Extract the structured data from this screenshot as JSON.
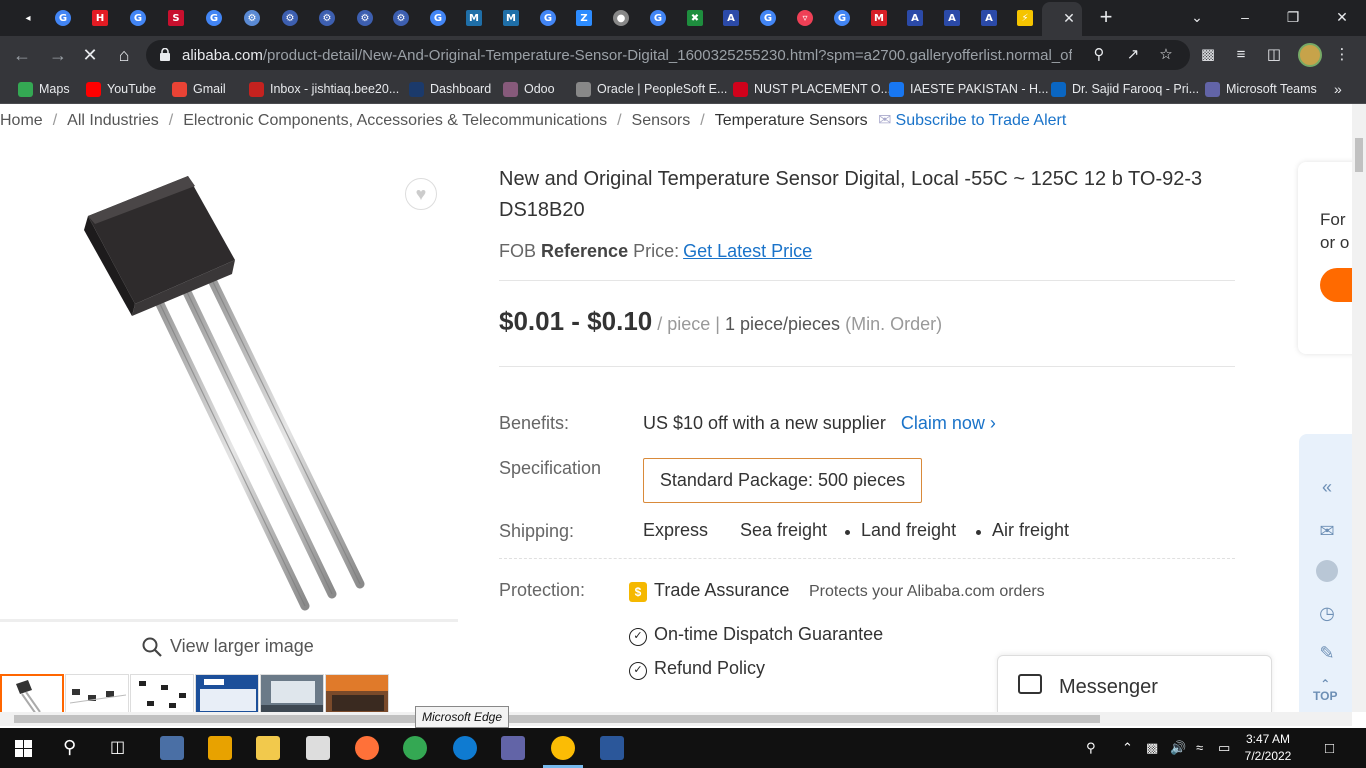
{
  "browser": {
    "url_host": "alibaba.com",
    "url_path": "/product-detail/New-And-Original-Temperature-Sensor-Digital_1600325255230.html?spm=a2700.galleryofferlist.normal_off...",
    "tooltip": "Microsoft Edge",
    "tabs": [
      {
        "icon": "speaker-icon",
        "color": "#202124",
        "glyph": "◂"
      },
      {
        "icon": "google-icon",
        "color": "#4285f4",
        "glyph": "G"
      },
      {
        "icon": "h-icon",
        "color": "#e31b23",
        "glyph": "H"
      },
      {
        "icon": "google-icon",
        "color": "#4285f4",
        "glyph": "G"
      },
      {
        "icon": "s-icon",
        "color": "#c8102e",
        "glyph": "S"
      },
      {
        "icon": "google-icon",
        "color": "#4285f4",
        "glyph": "G"
      },
      {
        "icon": "gear-icon",
        "color": "#5a8ad4",
        "glyph": "⚙"
      },
      {
        "icon": "gear-icon",
        "color": "#3d5fb0",
        "glyph": "⚙"
      },
      {
        "icon": "gear-icon",
        "color": "#3d5fb0",
        "glyph": "⚙"
      },
      {
        "icon": "gear-icon",
        "color": "#3d5fb0",
        "glyph": "⚙"
      },
      {
        "icon": "gear-icon",
        "color": "#3d5fb0",
        "glyph": "⚙"
      },
      {
        "icon": "google-icon",
        "color": "#4285f4",
        "glyph": "G"
      },
      {
        "icon": "m-icon",
        "color": "#1f6fa8",
        "glyph": "M"
      },
      {
        "icon": "m-icon",
        "color": "#1f6fa8",
        "glyph": "M"
      },
      {
        "icon": "google-icon",
        "color": "#4285f4",
        "glyph": "G"
      },
      {
        "icon": "z-icon",
        "color": "#2d8cff",
        "glyph": "Z"
      },
      {
        "icon": "globe-icon",
        "color": "#888888",
        "glyph": "●"
      },
      {
        "icon": "google-icon",
        "color": "#4285f4",
        "glyph": "G"
      },
      {
        "icon": "sheets-icon",
        "color": "#1e8e3e",
        "glyph": "✖"
      },
      {
        "icon": "pdf-icon",
        "color": "#2b4aa8",
        "glyph": "A"
      },
      {
        "icon": "google-icon",
        "color": "#4285f4",
        "glyph": "G"
      },
      {
        "icon": "pocket-icon",
        "color": "#ef4056",
        "glyph": "▿"
      },
      {
        "icon": "google-icon",
        "color": "#4285f4",
        "glyph": "G"
      },
      {
        "icon": "mendeley-icon",
        "color": "#d71f26",
        "glyph": "M"
      },
      {
        "icon": "pdf-icon",
        "color": "#2b4aa8",
        "glyph": "A"
      },
      {
        "icon": "pdf-icon",
        "color": "#2b4aa8",
        "glyph": "A"
      },
      {
        "icon": "pdf-icon",
        "color": "#2b4aa8",
        "glyph": "A"
      },
      {
        "icon": "bolt-icon",
        "color": "#f5c400",
        "glyph": "⚡"
      },
      {
        "icon": "alibaba-icon",
        "color": "#ff6a00",
        "glyph": "a",
        "active": true
      }
    ]
  },
  "bookmarks": [
    {
      "label": "Maps",
      "color": "#34a853"
    },
    {
      "label": "YouTube",
      "color": "#ff0000"
    },
    {
      "label": "Gmail",
      "color": "#ea4335"
    },
    {
      "label": "Inbox - jishtiaq.bee20...",
      "color": "#c5221f"
    },
    {
      "label": "Dashboard",
      "color": "#1b3a6b"
    },
    {
      "label": "Odoo",
      "color": "#875a7b"
    },
    {
      "label": "Oracle | PeopleSoft E...",
      "color": "#888888"
    },
    {
      "label": "NUST PLACEMENT O...",
      "color": "#d0021b"
    },
    {
      "label": "IAESTE PAKISTAN - H...",
      "color": "#1877f2"
    },
    {
      "label": "Dr. Sajid Farooq - Pri...",
      "color": "#0a66c2"
    },
    {
      "label": "Microsoft Teams",
      "color": "#6264a7"
    }
  ],
  "breadcrumb": {
    "items": [
      "Home",
      "All Industries",
      "Electronic Components, Accessories & Telecommunications",
      "Sensors",
      "Temperature Sensors"
    ],
    "subscribe": "Subscribe to Trade Alert"
  },
  "product": {
    "title": "New and Original Temperature Sensor Digital, Local -55C ~ 125C 12 b TO-92-3 DS18B20",
    "fob_prefix": "FOB",
    "fob_bold": "Reference",
    "fob_suffix": "Price:",
    "get_price": "Get Latest Price",
    "price": "$0.01 - $0.10",
    "price_unit": "/ piece |",
    "moq": "1 piece/pieces",
    "moq_suffix": "(Min. Order)",
    "view_larger": "View larger image"
  },
  "details": {
    "benefits_label": "Benefits:",
    "benefits_value": "US $10 off with a new supplier",
    "claim": "Claim now",
    "spec_label": "Specification",
    "spec_value": "Standard Package: 500 pieces",
    "shipping_label": "Shipping:",
    "shipping": [
      "Express",
      "Sea freight",
      "Land freight",
      "Air freight"
    ],
    "protection_label": "Protection:",
    "trade_assurance": "Trade Assurance",
    "trade_assurance_desc": "Protects your Alibaba.com orders",
    "guarantees": [
      "On-time Dispatch Guarantee",
      "Refund Policy"
    ]
  },
  "right_card": {
    "line1": "For",
    "line2": "or o"
  },
  "sidebar": {
    "top_label": "TOP"
  },
  "messenger": {
    "label": "Messenger"
  },
  "clock": {
    "time": "3:47 AM",
    "date": "7/2/2022"
  }
}
